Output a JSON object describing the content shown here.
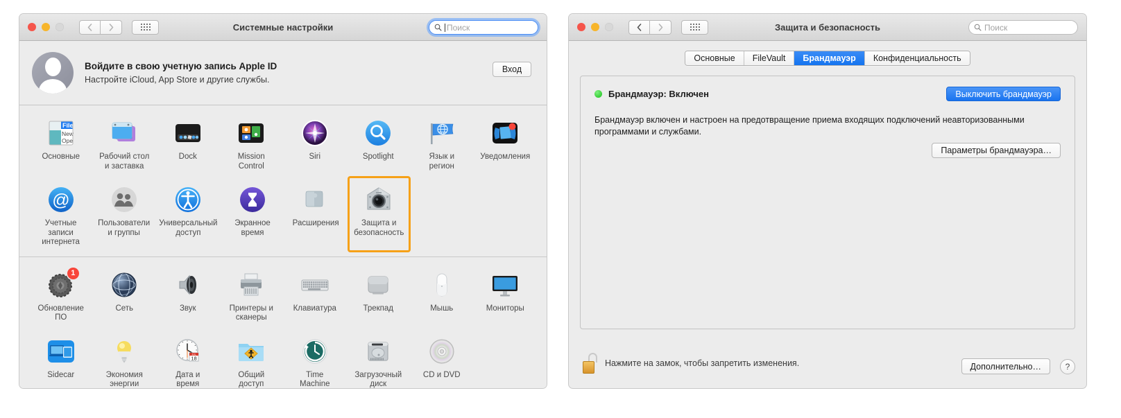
{
  "left_window": {
    "title": "Системные настройки",
    "traffic_lights": [
      "close",
      "minimize",
      "zoom-disabled"
    ],
    "nav": {
      "back_icon": "chevron-left-icon",
      "forward_icon": "chevron-right-icon",
      "grid_icon": "grid-view-icon"
    },
    "search": {
      "placeholder": "Поиск",
      "value": "",
      "focused": true,
      "accent": "#4b8ef5"
    },
    "apple_id": {
      "title": "Войдите в свою учетную запись Apple ID",
      "subtitle": "Настройте iCloud, App Store и другие службы.",
      "button": "Вход",
      "avatar_icon": "user-placeholder-avatar"
    },
    "highlight_color": "#f6a118",
    "groups": [
      {
        "rows": [
          [
            {
              "label": "Основные",
              "icon": "general-prefs-icon",
              "highlight": false
            },
            {
              "label": "Рабочий стол\nи заставка",
              "icon": "desktop-screensaver-icon",
              "highlight": false
            },
            {
              "label": "Dock",
              "icon": "dock-icon",
              "highlight": false
            },
            {
              "label": "Mission\nControl",
              "icon": "mission-control-icon",
              "highlight": false
            },
            {
              "label": "Siri",
              "icon": "siri-icon",
              "highlight": false
            },
            {
              "label": "Spotlight",
              "icon": "spotlight-icon",
              "highlight": false
            },
            {
              "label": "Язык и\nрегион",
              "icon": "language-region-icon",
              "highlight": false
            },
            {
              "label": "Уведомления",
              "icon": "notifications-icon",
              "highlight": false,
              "badge": ""
            }
          ],
          [
            {
              "label": "Учетные записи\nинтернета",
              "icon": "internet-accounts-icon",
              "highlight": false
            },
            {
              "label": "Пользователи\nи группы",
              "icon": "users-groups-icon",
              "highlight": false
            },
            {
              "label": "Универсальный\nдоступ",
              "icon": "accessibility-icon",
              "highlight": false
            },
            {
              "label": "Экранное\nвремя",
              "icon": "screen-time-icon",
              "highlight": false
            },
            {
              "label": "Расширения",
              "icon": "extensions-icon",
              "highlight": false
            },
            {
              "label": "Защита и\nбезопасность",
              "icon": "security-privacy-icon",
              "highlight": true
            },
            {
              "label": "",
              "icon": "",
              "highlight": false
            },
            {
              "label": "",
              "icon": "",
              "highlight": false
            }
          ]
        ]
      },
      {
        "rows": [
          [
            {
              "label": "Обновление\nПО",
              "icon": "software-update-icon",
              "highlight": false,
              "badge": "1"
            },
            {
              "label": "Сеть",
              "icon": "network-icon",
              "highlight": false
            },
            {
              "label": "Звук",
              "icon": "sound-icon",
              "highlight": false
            },
            {
              "label": "Принтеры и\nсканеры",
              "icon": "printers-scanners-icon",
              "highlight": false
            },
            {
              "label": "Клавиатура",
              "icon": "keyboard-icon",
              "highlight": false
            },
            {
              "label": "Трекпад",
              "icon": "trackpad-icon",
              "highlight": false
            },
            {
              "label": "Мышь",
              "icon": "mouse-icon",
              "highlight": false
            },
            {
              "label": "Мониторы",
              "icon": "displays-icon",
              "highlight": false
            }
          ],
          [
            {
              "label": "Sidecar",
              "icon": "sidecar-icon",
              "highlight": false
            },
            {
              "label": "Экономия\nэнергии",
              "icon": "energy-saver-icon",
              "highlight": false
            },
            {
              "label": "Дата и\nвремя",
              "icon": "date-time-icon",
              "highlight": false
            },
            {
              "label": "Общий\nдоступ",
              "icon": "sharing-icon",
              "highlight": false
            },
            {
              "label": "Time\nMachine",
              "icon": "time-machine-icon",
              "highlight": false
            },
            {
              "label": "Загрузочный\nдиск",
              "icon": "startup-disk-icon",
              "highlight": false
            },
            {
              "label": "CD и DVD",
              "icon": "cd-dvd-icon",
              "highlight": false
            },
            {
              "label": "",
              "icon": "",
              "highlight": false
            }
          ]
        ]
      }
    ]
  },
  "right_window": {
    "title": "Защита и безопасность",
    "search": {
      "placeholder": "Поиск",
      "value": "",
      "focused": false
    },
    "tabs": [
      {
        "label": "Основные",
        "active": false
      },
      {
        "label": "FileVault",
        "active": false
      },
      {
        "label": "Брандмауэр",
        "active": true
      },
      {
        "label": "Конфиденциальность",
        "active": false
      }
    ],
    "firewall": {
      "status_text": "Брандмауэр: Включен",
      "status_color": "#18c018",
      "toggle_button": "Выключить брандмауэр",
      "description": "Брандмауэр включен и настроен на предотвращение приема входящих подключений неавторизованными программами и службами.",
      "options_button": "Параметры брандмауэра…"
    },
    "footer": {
      "lock_icon": "unlocked-padlock-icon",
      "lock_text": "Нажмите на замок, чтобы запретить изменения.",
      "advanced_button": "Дополнительно…",
      "help_button": "?"
    }
  }
}
